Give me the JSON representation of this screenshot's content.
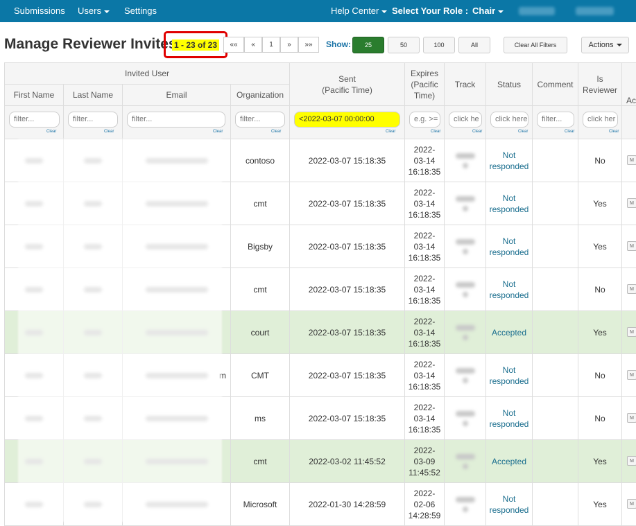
{
  "nav": {
    "submissions": "Submissions",
    "users": "Users",
    "settings": "Settings",
    "help_center": "Help Center",
    "select_role_label": "Select Your Role :",
    "role": "Chair"
  },
  "title": "Manage Reviewer Invites",
  "pager": {
    "count": "1 - 23 of 23",
    "first": "««",
    "prev": "«",
    "page": "1",
    "next": "»",
    "last": "»»"
  },
  "show": {
    "label": "Show:",
    "options": [
      "25",
      "50",
      "100",
      "All"
    ],
    "selected": "25"
  },
  "buttons": {
    "clear_filters": "Clear All Filters",
    "actions": "Actions"
  },
  "table": {
    "group_header": "Invited User",
    "headers": {
      "first_name": "First Name",
      "last_name": "Last Name",
      "email": "Email",
      "organization": "Organization",
      "sent_line1": "Sent",
      "sent_line2": "(Pacific Time)",
      "expires_line1": "Expires",
      "expires_line2": "(Pacific",
      "expires_line3": "Time)",
      "track": "Track",
      "status": "Status",
      "comment": "Comment",
      "is_reviewer_line1": "Is",
      "is_reviewer_line2": "Reviewer",
      "actions": "Ac"
    },
    "filters": {
      "first_name": "filter...",
      "last_name": "filter...",
      "email": "filter...",
      "organization": "filter...",
      "sent": "<2022-03-07 00:00:00",
      "expires": "e.g. >=",
      "track": "click he",
      "status": "click here",
      "comment": "filter...",
      "is_reviewer": "click her",
      "clear": "Clear"
    },
    "rows": [
      {
        "org": "contoso",
        "sent": "2022-03-07 15:18:35",
        "exp1": "2022-",
        "exp2": "03-14",
        "exp3": "16:18:35",
        "status1": "Not",
        "status2": "responded",
        "reviewer": "No",
        "accepted": false
      },
      {
        "org": "cmt",
        "sent": "2022-03-07 15:18:35",
        "exp1": "2022-",
        "exp2": "03-14",
        "exp3": "16:18:35",
        "status1": "Not",
        "status2": "responded",
        "reviewer": "Yes",
        "accepted": false
      },
      {
        "org": "Bigsby",
        "sent": "2022-03-07 15:18:35",
        "exp1": "2022-",
        "exp2": "03-14",
        "exp3": "16:18:35",
        "status1": "Not",
        "status2": "responded",
        "reviewer": "Yes",
        "accepted": false
      },
      {
        "org": "cmt",
        "sent": "2022-03-07 15:18:35",
        "exp1": "2022-",
        "exp2": "03-14",
        "exp3": "16:18:35",
        "status1": "Not",
        "status2": "responded",
        "reviewer": "No",
        "accepted": false
      },
      {
        "org": "court",
        "sent": "2022-03-07 15:18:35",
        "exp1": "2022-",
        "exp2": "03-14",
        "exp3": "16:18:35",
        "status1": "Accepted",
        "status2": "",
        "reviewer": "Yes",
        "accepted": true
      },
      {
        "org": "CMT",
        "sent": "2022-03-07 15:18:35",
        "exp1": "2022-",
        "exp2": "03-14",
        "exp3": "16:18:35",
        "status1": "Not",
        "status2": "responded",
        "reviewer": "No",
        "accepted": false
      },
      {
        "org": "ms",
        "sent": "2022-03-07 15:18:35",
        "exp1": "2022-",
        "exp2": "03-14",
        "exp3": "16:18:35",
        "status1": "Not",
        "status2": "responded",
        "reviewer": "No",
        "accepted": false
      },
      {
        "org": "cmt",
        "sent": "2022-03-02 11:45:52",
        "exp1": "2022-",
        "exp2": "03-09",
        "exp3": "11:45:52",
        "status1": "Accepted",
        "status2": "",
        "reviewer": "Yes",
        "accepted": true
      },
      {
        "org": "Microsoft",
        "sent": "2022-01-30 14:28:59",
        "exp1": "2022-",
        "exp2": "02-06",
        "exp3": "14:28:59",
        "status1": "Not",
        "status2": "responded",
        "reviewer": "Yes",
        "accepted": false
      }
    ],
    "email_suffix_row6": "m",
    "row_action_label": "M"
  },
  "colors": {
    "navbar": "#0b77a6",
    "accepted_row": "#e0efd8",
    "highlight": "#ffff00",
    "annotation_border": "#e00000",
    "active_button": "#2a7d2e"
  }
}
